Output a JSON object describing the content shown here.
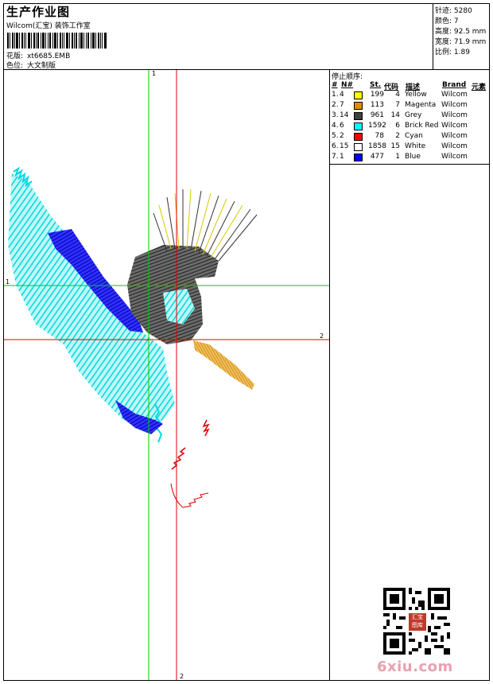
{
  "header": {
    "title": "生产作业图",
    "company": "Wilcom(汇宝) 装饰工作室",
    "pattern_label": "花版:",
    "pattern_value": "xt6685.EMB",
    "colorway_label": "色位:",
    "colorway_value": "大文制版"
  },
  "stats": {
    "stitches": "针迹: 5280",
    "colors": "颜色: 7",
    "height": "高度: 92.5 mm",
    "width": "宽度: 71.9 mm",
    "ratio": "比例: 1.89"
  },
  "stop_sequence": {
    "title": "停止顺序:",
    "headers": {
      "num": "#",
      "n": "N#",
      "stitches": "St.",
      "code": "代码",
      "desc": "描述",
      "brand": "Brand",
      "element": "元素"
    },
    "rows": [
      {
        "index": "1.",
        "n": "4",
        "color": "#ffff00",
        "stitches": "199",
        "code": "4",
        "desc": "Yellow",
        "brand": "Wilcom"
      },
      {
        "index": "2.",
        "n": "7",
        "color": "#e08a00",
        "stitches": "113",
        "code": "7",
        "desc": "Magenta",
        "brand": "Wilcom"
      },
      {
        "index": "3.",
        "n": "14",
        "color": "#404040",
        "stitches": "961",
        "code": "14",
        "desc": "Grey",
        "brand": "Wilcom"
      },
      {
        "index": "4.",
        "n": "6",
        "color": "#00ffff",
        "stitches": "1592",
        "code": "6",
        "desc": "Brick Red",
        "brand": "Wilcom"
      },
      {
        "index": "5.",
        "n": "2",
        "color": "#ff0000",
        "stitches": "78",
        "code": "2",
        "desc": "Cyan",
        "brand": "Wilcom"
      },
      {
        "index": "6.",
        "n": "15",
        "color": "#ffffff",
        "stitches": "1858",
        "code": "15",
        "desc": "White",
        "brand": "Wilcom"
      },
      {
        "index": "7.",
        "n": "1",
        "color": "#0000ff",
        "stitches": "477",
        "code": "1",
        "desc": "Blue",
        "brand": "Wilcom"
      }
    ]
  },
  "axes": {
    "green_v_label": "1",
    "green_h_label": "1",
    "red_v_label": "2",
    "red_h_label": "2",
    "green_color": "#00cc00",
    "red_color": "#e00000"
  },
  "qr": {
    "badge": "汇宝 图库"
  },
  "brand": {
    "text": "6xiu.com"
  }
}
